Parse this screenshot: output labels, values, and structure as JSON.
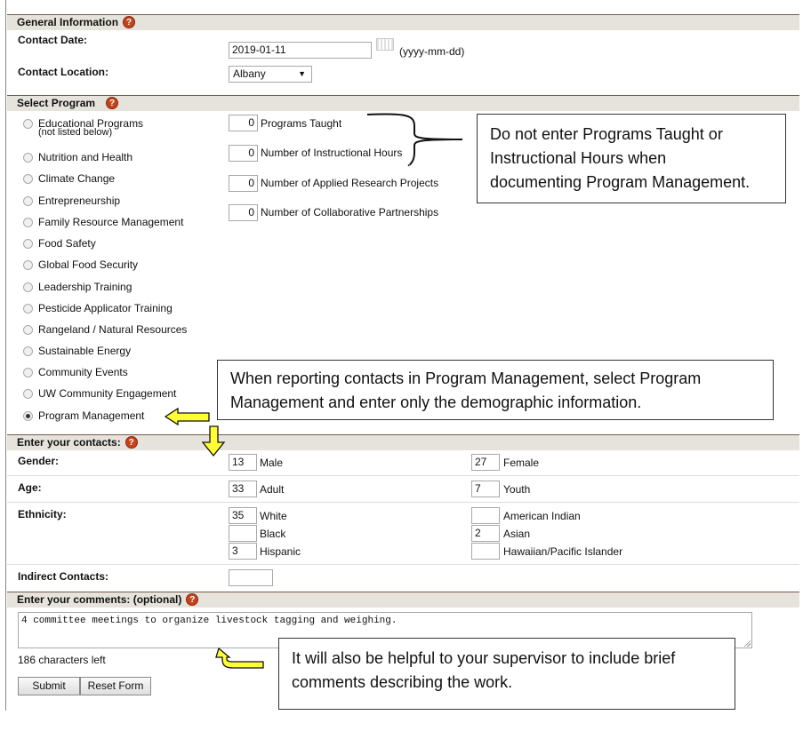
{
  "general": {
    "header": "General Information",
    "contact_date_label": "Contact Date:",
    "contact_date_value": "2019-01-11",
    "date_hint": "(yyyy-mm-dd)",
    "contact_location_label": "Contact Location:",
    "contact_location_value": "Albany"
  },
  "select_program": {
    "header": "Select Program",
    "programs": [
      {
        "label": "Educational Programs",
        "sub": "(not listed below)",
        "checked": false
      },
      {
        "label": "Nutrition and Health",
        "checked": false
      },
      {
        "label": "Climate Change",
        "checked": false
      },
      {
        "label": "Entrepreneurship",
        "checked": false
      },
      {
        "label": "Family Resource Management",
        "checked": false
      },
      {
        "label": "Food Safety",
        "checked": false
      },
      {
        "label": "Global Food Security",
        "checked": false
      },
      {
        "label": "Leadership Training",
        "checked": false
      },
      {
        "label": "Pesticide Applicator Training",
        "checked": false
      },
      {
        "label": "Rangeland / Natural Resources",
        "checked": false
      },
      {
        "label": "Sustainable Energy",
        "checked": false
      },
      {
        "label": "Community Events",
        "checked": false
      },
      {
        "label": "UW Community Engagement",
        "checked": false
      },
      {
        "label": "Program Management",
        "checked": true
      }
    ],
    "metrics": [
      {
        "value": "0",
        "label": "Programs Taught"
      },
      {
        "value": "0",
        "label": "Number of Instructional Hours"
      },
      {
        "value": "0",
        "label": "Number of Applied Research Projects"
      },
      {
        "value": "0",
        "label": "Number of Collaborative Partnerships"
      }
    ]
  },
  "contacts": {
    "header": "Enter your contacts:",
    "gender_label": "Gender:",
    "male_value": "13",
    "male_label": "Male",
    "female_value": "27",
    "female_label": "Female",
    "age_label": "Age:",
    "adult_value": "33",
    "adult_label": "Adult",
    "youth_value": "7",
    "youth_label": "Youth",
    "ethnicity_label": "Ethnicity:",
    "white_value": "35",
    "white_label": "White",
    "black_value": "",
    "black_label": "Black",
    "hispanic_value": "3",
    "hispanic_label": "Hispanic",
    "american_indian_value": "",
    "american_indian_label": "American Indian",
    "asian_value": "2",
    "asian_label": "Asian",
    "hawaiian_value": "",
    "hawaiian_label": "Hawaiian/Pacific Islander",
    "indirect_label": "Indirect Contacts:",
    "indirect_value": ""
  },
  "comments": {
    "header": "Enter your comments: (optional)",
    "value": "4 committee meetings to organize livestock tagging and weighing.",
    "chars_left": "186 characters left",
    "submit_label": "Submit",
    "reset_label": "Reset Form"
  },
  "callouts": {
    "programs_note": "Do not enter Programs Taught or\nInstructional Hours when\ndocumenting Program Management.",
    "management_note": "When reporting contacts in Program Management, select Program\nManagement and enter only the demographic information.",
    "comments_note": "It will also be helpful to your supervisor to include brief\ncomments describing the work."
  },
  "icons": {
    "help": "help-icon",
    "calendar": "calendar-icon",
    "dropdown": "chevron-down-icon"
  },
  "colors": {
    "section_header_bg": "#e6e3dc",
    "help_icon": "#c4431b",
    "arrow_fill": "#ffff33"
  }
}
